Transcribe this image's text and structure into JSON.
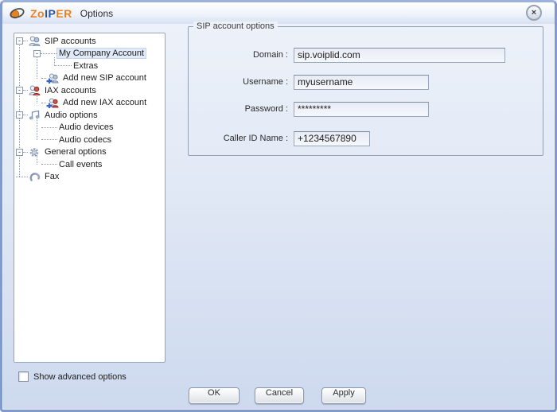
{
  "window": {
    "logo": {
      "zo": "Zo",
      "ip": "IP",
      "er": "ER"
    },
    "title": "Options",
    "close_glyph": "×"
  },
  "tree": {
    "collapse_glyph": "-",
    "items": [
      {
        "label": "SIP accounts",
        "level": 0,
        "expander": "-",
        "icon": "sip-accounts-icon",
        "selected": false
      },
      {
        "label": "My Company Account",
        "level": 1,
        "expander": "-",
        "icon": null,
        "selected": true
      },
      {
        "label": "Extras",
        "level": 2,
        "expander": null,
        "icon": null,
        "selected": false
      },
      {
        "label": "Add new SIP account",
        "level": 1,
        "expander": null,
        "icon": "add-sip-account-icon",
        "selected": false
      },
      {
        "label": "IAX accounts",
        "level": 0,
        "expander": "-",
        "icon": "iax-accounts-icon",
        "selected": false
      },
      {
        "label": "Add new IAX account",
        "level": 1,
        "expander": null,
        "icon": "add-iax-account-icon",
        "selected": false
      },
      {
        "label": "Audio options",
        "level": 0,
        "expander": "-",
        "icon": "audio-options-icon",
        "selected": false
      },
      {
        "label": "Audio devices",
        "level": 1,
        "expander": null,
        "icon": null,
        "selected": false
      },
      {
        "label": "Audio codecs",
        "level": 1,
        "expander": null,
        "icon": null,
        "selected": false
      },
      {
        "label": "General options",
        "level": 0,
        "expander": "-",
        "icon": "general-options-icon",
        "selected": false
      },
      {
        "label": "Call events",
        "level": 1,
        "expander": null,
        "icon": null,
        "selected": false
      },
      {
        "label": "Fax",
        "level": 0,
        "expander": null,
        "icon": "fax-icon",
        "selected": false
      }
    ]
  },
  "panel": {
    "group_title": "SIP account options",
    "fields": [
      {
        "label": "Domain :",
        "value": "sip.voiplid.com"
      },
      {
        "label": "Username :",
        "value": "myusername"
      },
      {
        "label": "Password :",
        "value": "*********",
        "masked": true
      },
      {
        "label": "Caller ID Name :",
        "value": "+1234567890"
      }
    ]
  },
  "footer": {
    "checkbox_label": "Show advanced options",
    "checkbox_checked": false,
    "buttons": [
      {
        "label": "OK"
      },
      {
        "label": "Cancel"
      },
      {
        "label": "Apply"
      }
    ]
  },
  "colors": {
    "window_border": "#8099cf",
    "background_bottom": "#cdd9ee",
    "logo_orange": "#ee7f1c",
    "logo_blue": "#31549f",
    "selection_bg": "#e1eaf8",
    "iax_red": "#c24434"
  }
}
